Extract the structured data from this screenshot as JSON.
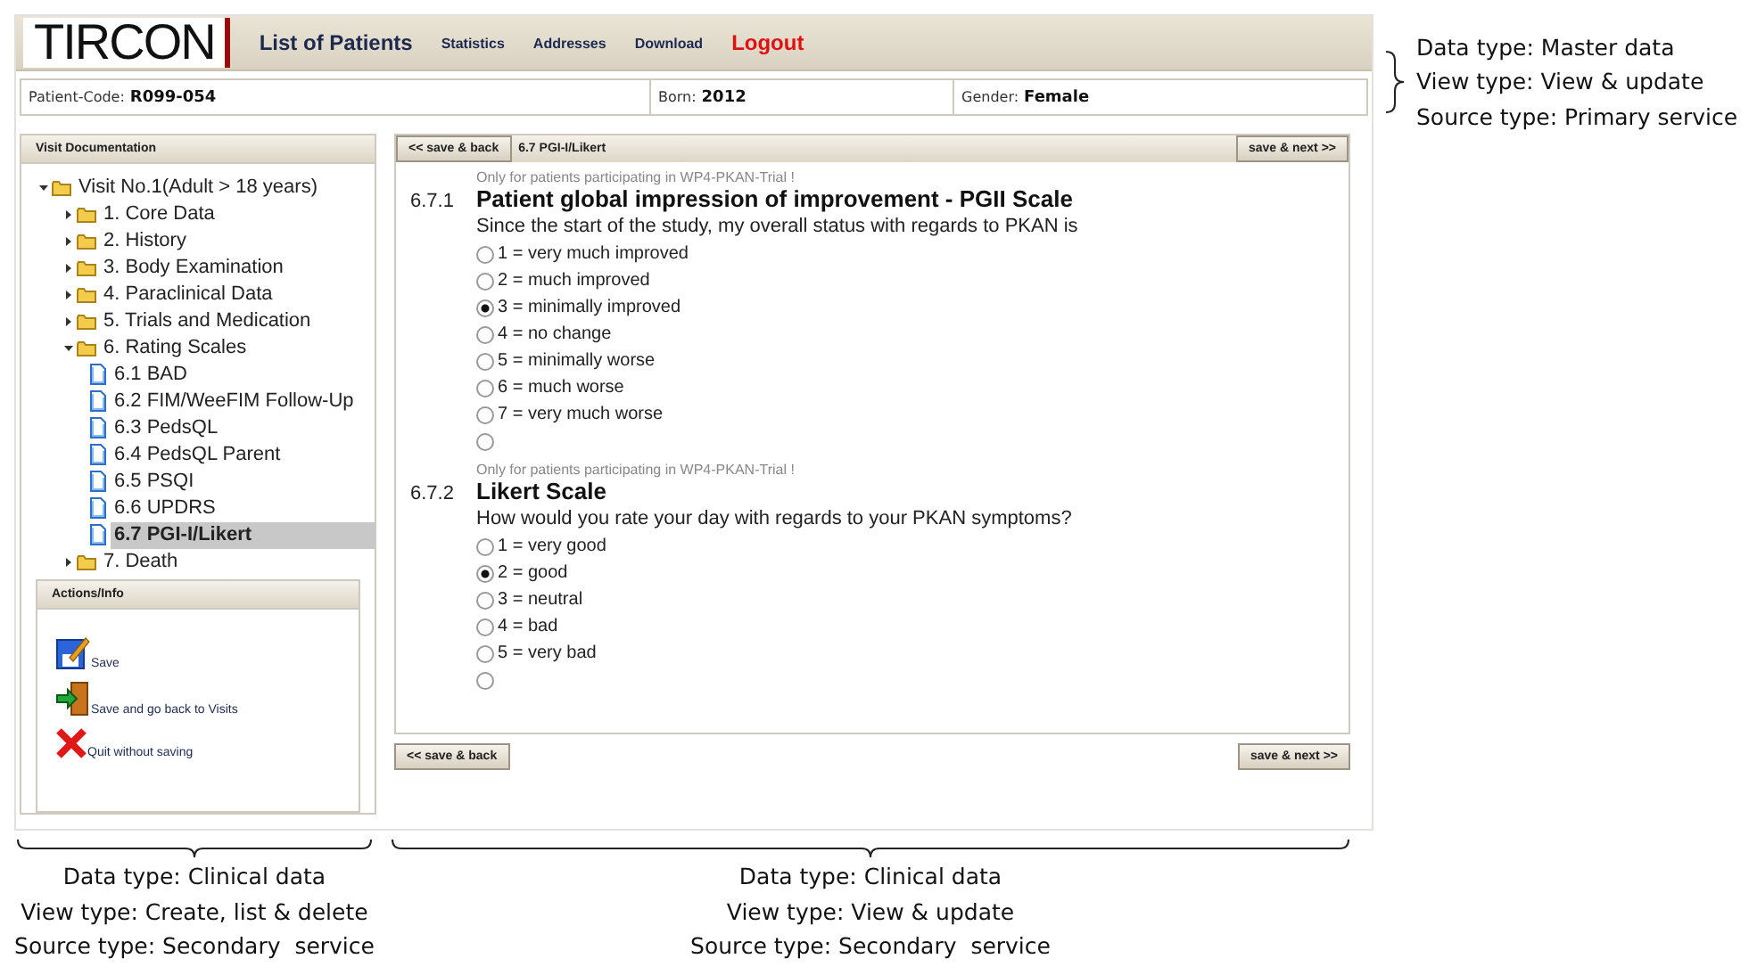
{
  "header": {
    "logo": "TIRCON",
    "title": "List of Patients",
    "nav": [
      "Statistics",
      "Addresses",
      "Download"
    ],
    "logout": "Logout"
  },
  "patient": [
    {
      "label": "Patient-Code:",
      "value": "R099-054"
    },
    {
      "label": "Born:",
      "value": "2012"
    },
    {
      "label": "Gender:",
      "value": "Female"
    }
  ],
  "sidebar": {
    "title": "Visit Documentation",
    "tree": [
      {
        "kind": "folder",
        "label": "Visit No.1(Adult > 18 years)",
        "expanded": true,
        "selected": false,
        "children": [
          {
            "kind": "folder",
            "label": "1. Core Data",
            "expanded": false,
            "selected": false
          },
          {
            "kind": "folder",
            "label": "2. History",
            "expanded": false,
            "selected": false
          },
          {
            "kind": "folder",
            "label": "3. Body Examination",
            "expanded": false,
            "selected": false
          },
          {
            "kind": "folder",
            "label": "4. Paraclinical Data",
            "expanded": false,
            "selected": false
          },
          {
            "kind": "folder",
            "label": "5. Trials and Medication",
            "expanded": false,
            "selected": false
          },
          {
            "kind": "folder",
            "label": "6. Rating Scales",
            "expanded": true,
            "selected": false,
            "children": [
              {
                "kind": "document",
                "label": "6.1 BAD",
                "selected": false
              },
              {
                "kind": "document",
                "label": "6.2 FIM/WeeFIM Follow-Up",
                "selected": false
              },
              {
                "kind": "document",
                "label": "6.3 PedsQL",
                "selected": false
              },
              {
                "kind": "document",
                "label": "6.4 PedsQL Parent",
                "selected": false
              },
              {
                "kind": "document",
                "label": "6.5 PSQI",
                "selected": false
              },
              {
                "kind": "document",
                "label": "6.6 UPDRS",
                "selected": false
              },
              {
                "kind": "document",
                "label": "6.7 PGI-I/Likert",
                "selected": true
              }
            ]
          },
          {
            "kind": "folder",
            "label": "7. Death",
            "expanded": false,
            "selected": false
          }
        ]
      }
    ],
    "actions_title": "Actions/Info",
    "actions": [
      {
        "kind": "save",
        "label": "Save"
      },
      {
        "kind": "exit",
        "label": "Save and go back to Visits"
      },
      {
        "kind": "quit",
        "label": "Quit without saving"
      }
    ]
  },
  "form": {
    "back": "<< save & back",
    "title": "6.7 PGI-I/Likert",
    "next": "save & next >>",
    "questions": [
      {
        "note": "Only for patients participating in WP4-PKAN-Trial !",
        "number": "6.7.1",
        "title": "Patient global impression of improvement - PGII Scale",
        "prompt": "Since the start of the study, my overall status with regards to PKAN is",
        "options": [
          {
            "label": "1 = very much improved",
            "selected": false
          },
          {
            "label": "2 = much improved",
            "selected": false
          },
          {
            "label": "3 = minimally improved",
            "selected": true
          },
          {
            "label": "4 = no change",
            "selected": false
          },
          {
            "label": "5 = minimally worse",
            "selected": false
          },
          {
            "label": "6 = much worse",
            "selected": false
          },
          {
            "label": "7 = very much worse",
            "selected": false
          },
          {
            "selected": false
          }
        ]
      },
      {
        "note": "Only for patients participating in WP4-PKAN-Trial !",
        "number": "6.7.2",
        "title": "Likert Scale",
        "prompt": "How would you rate your day with regards to your PKAN symptoms?",
        "options": [
          {
            "label": "1 = very good",
            "selected": false
          },
          {
            "label": "2 = good",
            "selected": true
          },
          {
            "label": "3 = neutral",
            "selected": false
          },
          {
            "label": "4 = bad",
            "selected": false
          },
          {
            "label": "5 = very bad",
            "selected": false
          },
          {
            "selected": false
          }
        ]
      }
    ],
    "bottom_back": "<< save & back",
    "bottom_next": "save & next >>"
  },
  "annotations": {
    "header": [
      "Data type: Master data",
      "View type: View & update",
      "Source type: Primary service"
    ],
    "sidebar": [
      "Data type: Clinical data",
      "View type: Create, list & delete",
      "Source type: Secondary  service"
    ],
    "form": [
      "Data type: Clinical data",
      "View type: View & update",
      "Source type: Secondary  service"
    ]
  }
}
